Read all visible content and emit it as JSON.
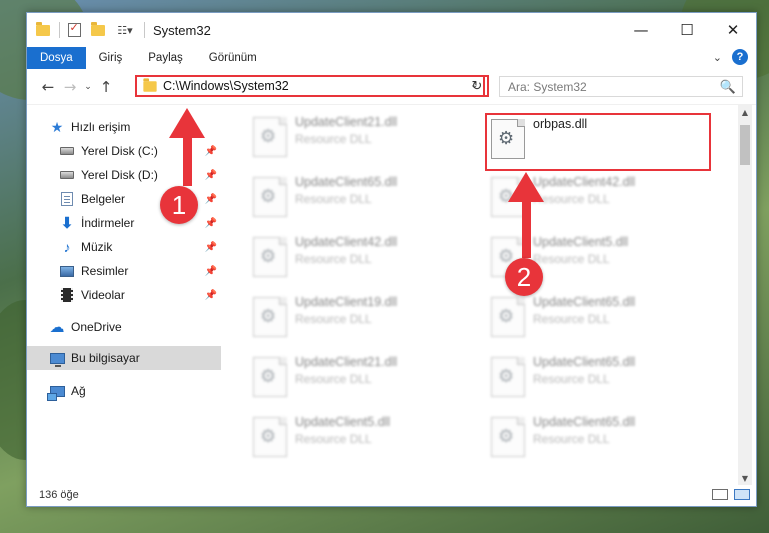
{
  "window": {
    "title": "System32",
    "minimize": "—",
    "maximize": "☐",
    "close": "✕"
  },
  "ribbon": {
    "tabs": [
      "Dosya",
      "Giriş",
      "Paylaş",
      "Görünüm"
    ],
    "help": "?",
    "expand": "⌄"
  },
  "navigation": {
    "back": "←",
    "forward": "→",
    "recent": "⌄",
    "up": "↑",
    "address": "C:\\Windows\\System32",
    "address_dropdown": "⌄",
    "refresh": "↻",
    "search_placeholder": "Ara: System32",
    "search_icon": "🔍"
  },
  "sidebar": {
    "quick_access": "Hızlı erişim",
    "items": [
      {
        "label": "Yerel Disk (C:)",
        "icon": "drive-icon",
        "pinned": true
      },
      {
        "label": "Yerel Disk (D:)",
        "icon": "drive-icon",
        "pinned": true
      },
      {
        "label": "Belgeler",
        "icon": "documents-icon",
        "pinned": true
      },
      {
        "label": "İndirmeler",
        "icon": "download-icon",
        "pinned": true
      },
      {
        "label": "Müzik",
        "icon": "music-icon",
        "pinned": true
      },
      {
        "label": "Resimler",
        "icon": "pictures-icon",
        "pinned": true
      },
      {
        "label": "Videolar",
        "icon": "videos-icon",
        "pinned": true
      }
    ],
    "onedrive": "OneDrive",
    "this_pc": "Bu bilgisayar",
    "network": "Ağ"
  },
  "files": {
    "highlighted": {
      "name": "orbpas.dll",
      "type": ""
    },
    "left_column": [
      {
        "name": "UpdateClient21.dll",
        "type": "Resource DLL"
      },
      {
        "name": "UpdateClient65.dll",
        "type": "Resource DLL"
      },
      {
        "name": "UpdateClient42.dll",
        "type": "Resource DLL"
      },
      {
        "name": "UpdateClient19.dll",
        "type": "Resource DLL"
      },
      {
        "name": "UpdateClient21.dll",
        "type": "Resource DLL"
      },
      {
        "name": "UpdateClient5.dll",
        "type": "Resource DLL"
      }
    ],
    "right_column": [
      {
        "name": "UpdateClient42.dll",
        "type": "Resource DLL"
      },
      {
        "name": "UpdateClient5.dll",
        "type": "Resource DLL"
      },
      {
        "name": "UpdateClient65.dll",
        "type": "Resource DLL"
      },
      {
        "name": "UpdateClient65.dll",
        "type": "Resource DLL"
      },
      {
        "name": "UpdateClient65.dll",
        "type": "Resource DLL"
      }
    ]
  },
  "status": {
    "item_count": "136 öğe"
  },
  "annotations": {
    "step1": "1",
    "step2": "2",
    "color": "#e8343a"
  }
}
